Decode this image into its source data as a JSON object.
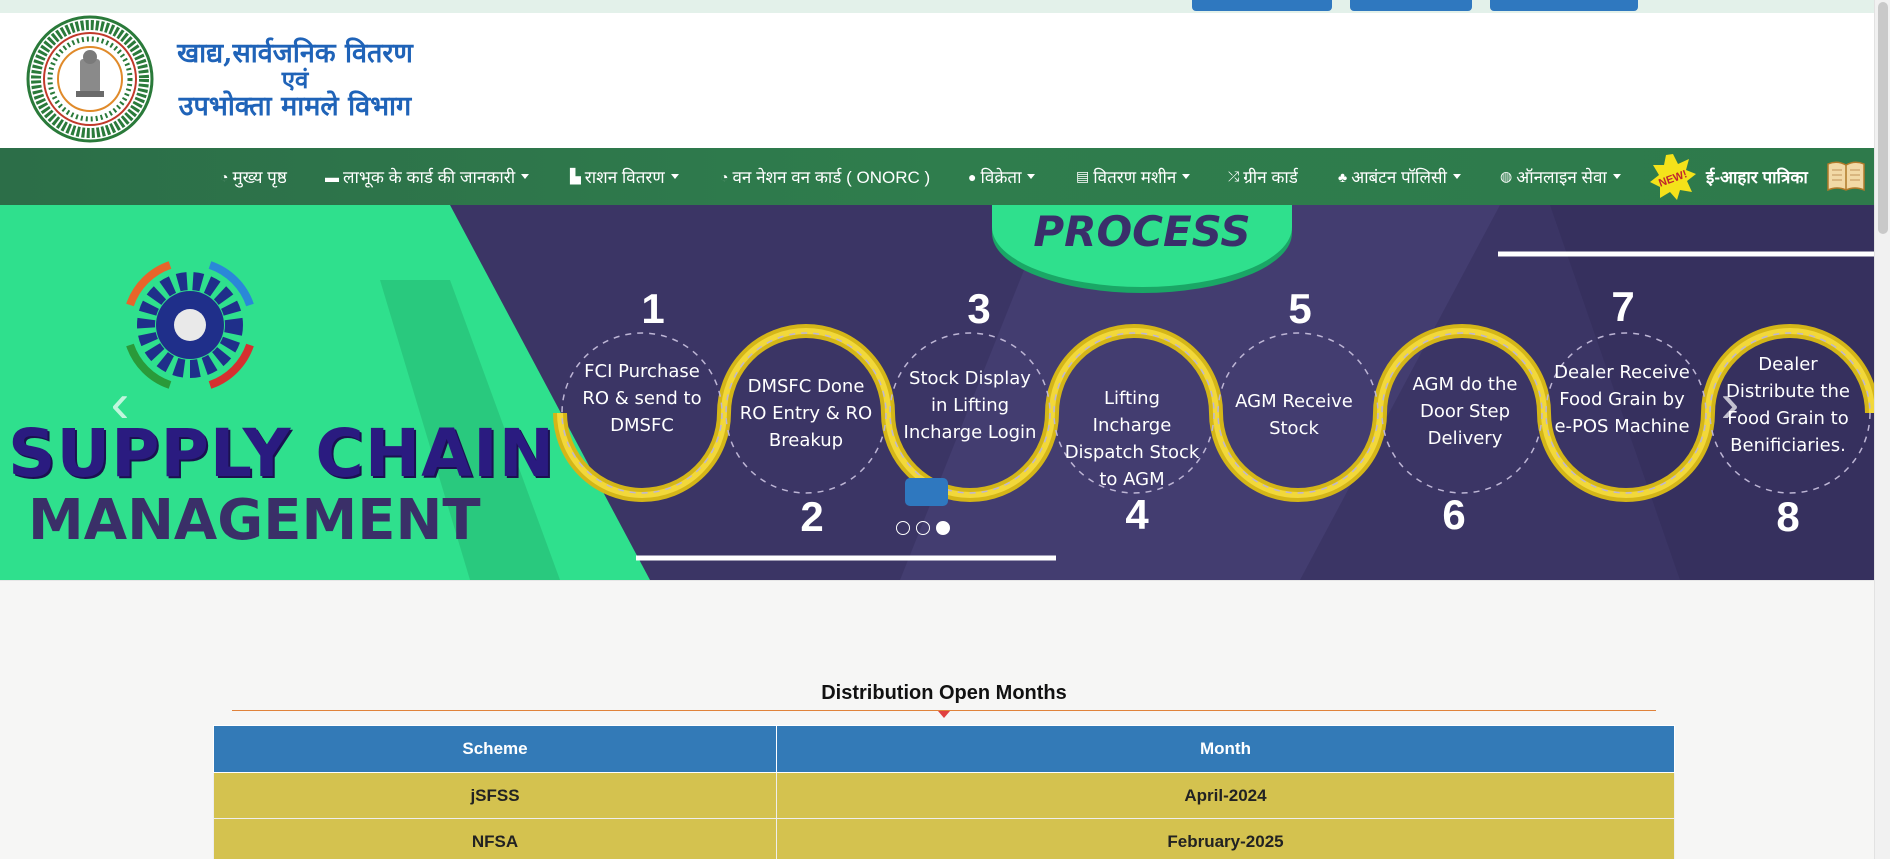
{
  "header": {
    "dept_line1": "खाद्य,सार्वजनिक वितरण",
    "dept_line2": "एवं",
    "dept_line3": "उपभोक्ता मामले विभाग",
    "logo_icon": "government-of-jharkhand-emblem-icon"
  },
  "nav": {
    "items": [
      {
        "icon": "◔",
        "label": "मुख्य पृष्ठ"
      },
      {
        "icon": "▬",
        "label": "लाभूक के कार्ड की जानकारी"
      },
      {
        "icon": "▙",
        "label": "राशन वितरण"
      },
      {
        "icon": "◔",
        "label": "वन नेशन वन कार्ड ( ONORC )"
      },
      {
        "icon": "●",
        "label": "विक्रेता"
      },
      {
        "icon": "▤",
        "label": "वितरण मशीन"
      },
      {
        "icon": "⤮",
        "label": "ग्रीन कार्ड"
      },
      {
        "icon": "♣",
        "label": "आबंटन पॉलिसी"
      },
      {
        "icon": "◍",
        "label": "ऑनलाइन सेवा"
      }
    ],
    "new_badge": "NEW!",
    "epatrika_label": "ई-आहार पात्रिका"
  },
  "carousel": {
    "heading_line1": "SUPPLY CHAIN",
    "heading_line2": "MANAGEMENT",
    "process_label": "PROCESS",
    "steps": [
      {
        "num": "1",
        "text": "FCI Purchase RO & send to DMSFC"
      },
      {
        "num": "2",
        "text": "DMSFC Done RO Entry & RO Breakup"
      },
      {
        "num": "3",
        "text": "Stock Display in Lifting Incharge Login"
      },
      {
        "num": "4",
        "text": "Lifting Incharge Dispatch Stock to AGM"
      },
      {
        "num": "5",
        "text": "AGM Receive Stock"
      },
      {
        "num": "6",
        "text": "AGM do the Door Step Delivery"
      },
      {
        "num": "7",
        "text": "Dealer Receive Food Grain by e-POS Machine"
      },
      {
        "num": "8",
        "text": "Dealer Distribute the Food Grain to Benificiaries."
      }
    ],
    "prev_arrow": "‹",
    "next_arrow": "›",
    "active_slide": 3,
    "slide_count": 3
  },
  "distribution": {
    "title": "Distribution Open Months",
    "columns": [
      "Scheme",
      "Month"
    ],
    "rows": [
      {
        "scheme": "jSFSS",
        "month": "April-2024"
      },
      {
        "scheme": "NFSA",
        "month": "February-2025"
      }
    ]
  },
  "colors": {
    "nav_green": "#2e7a4b",
    "table_header_blue": "#337ab7",
    "table_row_gold": "#d4c24f",
    "carousel_green": "#2fe08d",
    "carousel_purple": "#3b3565"
  }
}
